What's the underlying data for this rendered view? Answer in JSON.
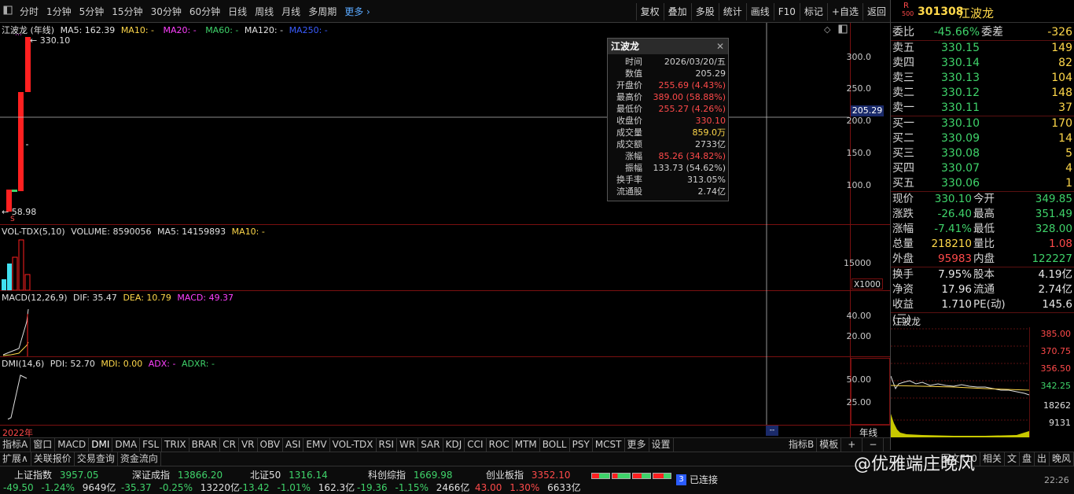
{
  "toolbar": {
    "items": [
      "分时",
      "1分钟",
      "5分钟",
      "15分钟",
      "30分钟",
      "60分钟",
      "日线",
      "周线",
      "月线",
      "多周期"
    ],
    "more": "更多",
    "right": [
      "复权",
      "叠加",
      "多股",
      "统计",
      "画线",
      "F10",
      "标记",
      "+自选",
      "返回"
    ]
  },
  "chart": {
    "title": "江波龙 (年线)",
    "ma": {
      "ma5": "MA5: 162.39",
      "ma10": "MA10: -",
      "ma20": "MA20: -",
      "ma60": "MA60: -",
      "ma120": "MA120: -",
      "ma250": "MA250: -"
    },
    "high_label": "330.10",
    "low_label": "58.98",
    "price_axis": [
      "300.0",
      "250.0",
      "200.0",
      "150.0",
      "100.0"
    ],
    "cursor_price": "205.29",
    "volume_legend": {
      "name": "VOL-TDX(5,10)",
      "volume": "VOLUME: 8590056",
      "ma5": "MA5: 14159893",
      "ma10": "MA10: -"
    },
    "volume_axis": [
      "15000"
    ],
    "volume_unit": "X1000",
    "macd_legend": {
      "name": "MACD(12,26,9)",
      "dif": "DIF: 35.47",
      "dea": "DEA: 10.79",
      "macd": "MACD: 49.37"
    },
    "macd_axis": [
      "40.00",
      "20.00"
    ],
    "dmi_legend": {
      "name": "DMI(14,6)",
      "pdi": "PDI: 52.70",
      "mdi": "MDI: 0.00",
      "adx": "ADX: -",
      "adxr": "ADXR: -"
    },
    "dmi_axis": [
      "50.00",
      "25.00"
    ],
    "year_label": "2022年",
    "period_label": "年线"
  },
  "tooltip": {
    "title": "江波龙",
    "rows": [
      {
        "k": "时间",
        "v": "2026/03/20/五",
        "c": "#d0d0d0"
      },
      {
        "k": "数值",
        "v": "205.29",
        "c": "#d0d0d0"
      },
      {
        "k": "开盘价",
        "v": "255.69 (4.43%)",
        "c": "#ff4a4a"
      },
      {
        "k": "最高价",
        "v": "389.00 (58.88%)",
        "c": "#ff4a4a"
      },
      {
        "k": "最低价",
        "v": "255.27 (4.26%)",
        "c": "#ff4a4a"
      },
      {
        "k": "收盘价",
        "v": "330.10",
        "c": "#ff4a4a"
      },
      {
        "k": "成交量",
        "v": "859.0万",
        "c": "#ffd84a"
      },
      {
        "k": "成交额",
        "v": "2733亿",
        "c": "#d0d0d0"
      },
      {
        "k": "涨幅",
        "v": "85.26 (34.82%)",
        "c": "#ff4a4a"
      },
      {
        "k": "振幅",
        "v": "133.73 (54.62%)",
        "c": "#d0d0d0"
      },
      {
        "k": "换手率",
        "v": "313.05%",
        "c": "#d0d0d0"
      },
      {
        "k": "流通股",
        "v": "2.74亿",
        "c": "#d0d0d0"
      }
    ]
  },
  "quote": {
    "code": "301308",
    "name": "江波龙",
    "badge_r": "R",
    "badge_num": "500",
    "weibi_label": "委比",
    "weibi": "-45.66%",
    "weicha_label": "委差",
    "weicha": "-326",
    "asks": [
      {
        "label": "卖五",
        "price": "330.15",
        "vol": "149"
      },
      {
        "label": "卖四",
        "price": "330.14",
        "vol": "82"
      },
      {
        "label": "卖三",
        "price": "330.13",
        "vol": "104"
      },
      {
        "label": "卖二",
        "price": "330.12",
        "vol": "148"
      },
      {
        "label": "卖一",
        "price": "330.11",
        "vol": "37"
      }
    ],
    "bids": [
      {
        "label": "买一",
        "price": "330.10",
        "vol": "170"
      },
      {
        "label": "买二",
        "price": "330.09",
        "vol": "14"
      },
      {
        "label": "买三",
        "price": "330.08",
        "vol": "5"
      },
      {
        "label": "买四",
        "price": "330.07",
        "vol": "4"
      },
      {
        "label": "买五",
        "price": "330.06",
        "vol": "1"
      }
    ],
    "stats1": [
      {
        "l1": "现价",
        "v1": "330.10",
        "c1": "green",
        "l2": "今开",
        "v2": "349.85",
        "c2": "green"
      },
      {
        "l1": "涨跌",
        "v1": "-26.40",
        "c1": "green",
        "l2": "最高",
        "v2": "351.49",
        "c2": "green"
      },
      {
        "l1": "涨幅",
        "v1": "-7.41%",
        "c1": "green",
        "l2": "最低",
        "v2": "328.00",
        "c2": "green"
      },
      {
        "l1": "总量",
        "v1": "218210",
        "c1": "yellow",
        "l2": "量比",
        "v2": "1.08",
        "c2": "red"
      },
      {
        "l1": "外盘",
        "v1": "95983",
        "c1": "red",
        "l2": "内盘",
        "v2": "122227",
        "c2": "green"
      }
    ],
    "stats2": [
      {
        "l1": "换手",
        "v1": "7.95%",
        "c1": "white",
        "l2": "股本",
        "v2": "4.19亿",
        "c2": "white"
      },
      {
        "l1": "净资",
        "v1": "17.96",
        "c1": "white",
        "l2": "流通",
        "v2": "2.74亿",
        "c2": "white"
      },
      {
        "l1": "收益(三)",
        "v1": "1.710",
        "c1": "white",
        "l2": "PE(动)",
        "v2": "145.6",
        "c2": "white"
      }
    ],
    "mini_title": "江波龙",
    "mini_axis": [
      "385.00",
      "370.75",
      "356.50",
      "342.25",
      "18262",
      "9131"
    ]
  },
  "indicator_tabs": [
    "指标A",
    "窗口",
    "MACD",
    "DMI",
    "DMA",
    "FSL",
    "TRIX",
    "BRAR",
    "CR",
    "VR",
    "OBV",
    "ASI",
    "EMV",
    "VOL-TDX",
    "RSI",
    "WR",
    "SAR",
    "KDJ",
    "CCI",
    "ROC",
    "MTM",
    "BOLL",
    "PSY",
    "MCST",
    "更多",
    "设置"
  ],
  "indicator_right": [
    "指标B",
    "模板",
    "+",
    "−"
  ],
  "bottom_tabs": [
    "扩展∧",
    "关联报价",
    "交易查询",
    "资金流向"
  ],
  "bottom_right": [
    "图文F10",
    "相关",
    "文",
    "盘",
    "出",
    "晚风"
  ],
  "indices": [
    {
      "name": "上证指数",
      "value": "3957.05",
      "chg": "-49.50",
      "pct": "-1.24%",
      "amt": "9649亿",
      "color": "green"
    },
    {
      "name": "深证成指",
      "value": "13866.20",
      "chg": "-35.37",
      "pct": "-0.25%",
      "amt": "13220亿",
      "color": "green"
    },
    {
      "name": "北证50",
      "value": "1316.14",
      "chg": "-13.42",
      "pct": "-1.01%",
      "amt": "162.3亿",
      "color": "green"
    },
    {
      "name": "科创综指",
      "value": "1669.98",
      "chg": "-19.36",
      "pct": "-1.15%",
      "amt": "2466亿",
      "color": "green"
    },
    {
      "name": "创业板指",
      "value": "3352.10",
      "chg": "43.00",
      "pct": "1.30%",
      "amt": "6633亿",
      "color": "red"
    }
  ],
  "connection": {
    "count": "3",
    "status": "已连接"
  },
  "watermark": "@优雅端庄晚风",
  "clock": "22:26"
}
